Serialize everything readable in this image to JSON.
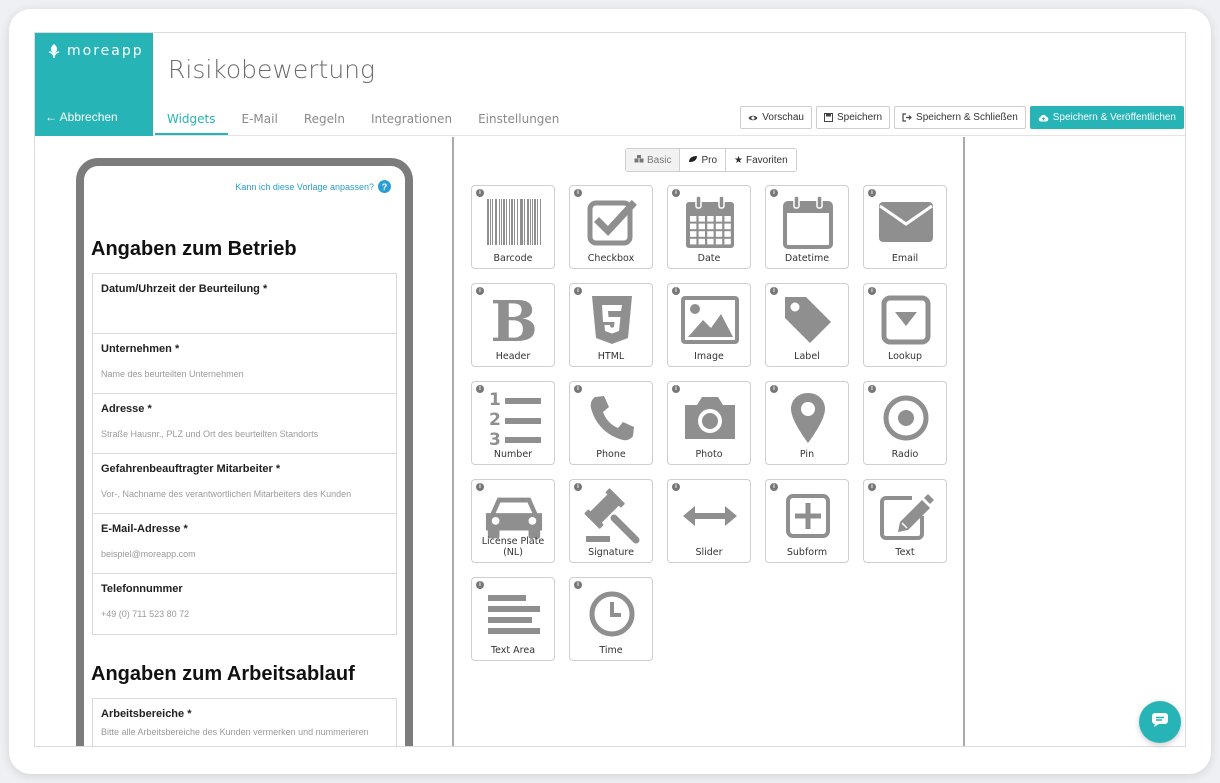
{
  "brand": {
    "name": "moreapp",
    "cancel_label": "Abbrechen",
    "color": "#27b4b6"
  },
  "page_title": "Risikobewertung",
  "tabs": [
    {
      "label": "Widgets",
      "active": true
    },
    {
      "label": "E-Mail"
    },
    {
      "label": "Regeln"
    },
    {
      "label": "Integrationen"
    },
    {
      "label": "Einstellungen"
    }
  ],
  "actions": {
    "preview": "Vorschau",
    "save": "Speichern",
    "save_close": "Speichern & Schließen",
    "save_publish": "Speichern & Veröffentlichen"
  },
  "preview": {
    "help_text": "Kann ich diese Vorlage anpassen?",
    "help_icon": "?",
    "section1_title": "Angaben zum Betrieb",
    "section1_fields": [
      {
        "label": "Datum/Uhrzeit der Beurteilung *",
        "placeholder": ""
      },
      {
        "label": "Unternehmen *",
        "placeholder": "Name des beurteilten Unternehmen"
      },
      {
        "label": "Adresse *",
        "placeholder": "Straße Hausnr., PLZ und Ort des beurteilten Standorts"
      },
      {
        "label": "Gefahrenbeauftragter Mitarbeiter *",
        "placeholder": "Vor-, Nachname des verantwortlichen Mitarbeiters des Kunden"
      },
      {
        "label": "E-Mail-Adresse *",
        "placeholder": "beispiel@moreapp.com"
      },
      {
        "label": "Telefonnummer",
        "placeholder": "+49 (0) 711 523 80 72"
      }
    ],
    "section2_title": "Angaben zum Arbeitsablauf",
    "section2_fields": [
      {
        "label": "Arbeitsbereiche *",
        "placeholder": "Bitte alle Arbeitsbereiche des Kunden vermerken und nummerieren"
      }
    ]
  },
  "palette": {
    "segments": {
      "basic": "Basic",
      "pro": "Pro",
      "favorites": "Favoriten"
    },
    "info_glyph": "i",
    "widgets": [
      {
        "label": "Barcode",
        "icon": "barcode-icon"
      },
      {
        "label": "Checkbox",
        "icon": "checkbox-icon"
      },
      {
        "label": "Date",
        "icon": "calendar-icon"
      },
      {
        "label": "Datetime",
        "icon": "calendar-outline-icon"
      },
      {
        "label": "Email",
        "icon": "envelope-icon"
      },
      {
        "label": "Header",
        "icon": "bold-b-icon"
      },
      {
        "label": "HTML",
        "icon": "html5-icon"
      },
      {
        "label": "Image",
        "icon": "image-icon"
      },
      {
        "label": "Label",
        "icon": "tag-icon"
      },
      {
        "label": "Lookup",
        "icon": "dropdown-box-icon"
      },
      {
        "label": "Number",
        "icon": "numbered-list-icon"
      },
      {
        "label": "Phone",
        "icon": "phone-icon"
      },
      {
        "label": "Photo",
        "icon": "camera-icon"
      },
      {
        "label": "Pin",
        "icon": "map-pin-icon"
      },
      {
        "label": "Radio",
        "icon": "radio-icon"
      },
      {
        "label": "License Plate (NL)",
        "icon": "car-icon"
      },
      {
        "label": "Signature",
        "icon": "gavel-icon"
      },
      {
        "label": "Slider",
        "icon": "arrows-horizontal-icon"
      },
      {
        "label": "Subform",
        "icon": "plus-square-icon"
      },
      {
        "label": "Text",
        "icon": "edit-icon"
      },
      {
        "label": "Text Area",
        "icon": "text-lines-icon"
      },
      {
        "label": "Time",
        "icon": "clock-icon"
      }
    ]
  }
}
